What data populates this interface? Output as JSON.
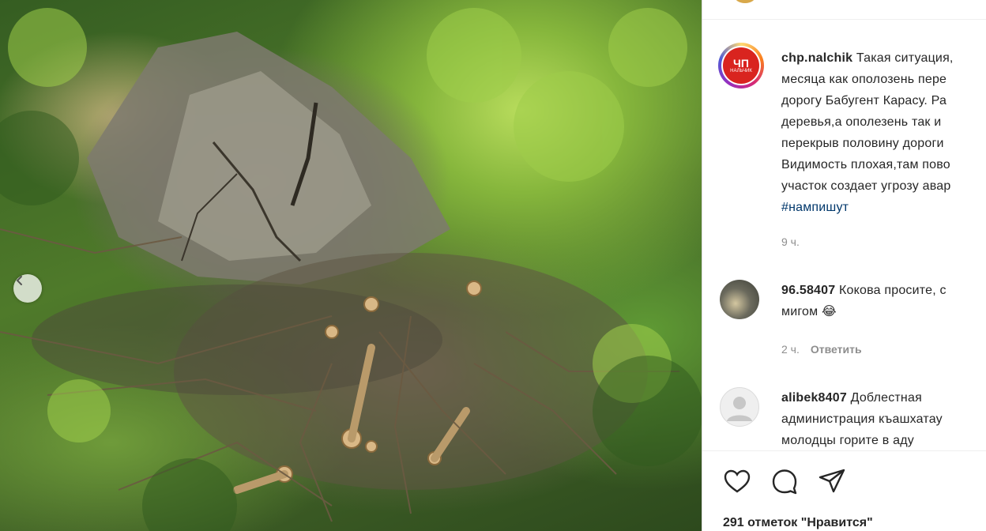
{
  "post": {
    "author": "chp.nalchik",
    "avatar_logo_text": "ЧП",
    "avatar_logo_subtext": "НАЛЬЧИК",
    "caption_lines": [
      "Такая ситуация,",
      "месяца как ополозень пере",
      "дорогу Бабугент Карасу. Ра",
      "деревья,а ополезень так и",
      "перекрыв половину дороги",
      "Видимость плохая,там пово",
      "участок создает угрозу авар"
    ],
    "hashtag": "#нампишут",
    "time": "9 ч.",
    "likes": "291 отметок \"Нравится\""
  },
  "comments": [
    {
      "user": "96.58407",
      "text_lines": [
        "Кокова просите, с",
        "мигом 😂"
      ],
      "time": "2 ч.",
      "reply_label": "Ответить"
    },
    {
      "user": "alibek8407",
      "text_lines": [
        "Доблестная",
        "администрация къашхатау",
        "молодцы горите в аду"
      ]
    }
  ],
  "icons": {
    "carousel_prev": "chevron-left-icon",
    "like": "heart-icon",
    "comment": "comment-bubble-icon",
    "share": "paper-plane-icon"
  },
  "colors": {
    "link": "#00376b",
    "muted": "#8e8e8e",
    "text": "#262626",
    "avatar_red": "#d9241f"
  }
}
